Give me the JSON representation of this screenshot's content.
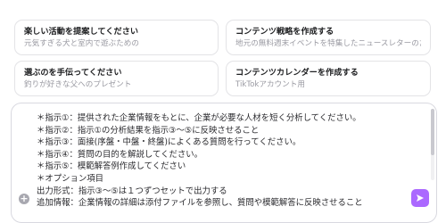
{
  "suggestions": [
    {
      "title": "楽しい活動を提案してください",
      "subtitle": "元気すぎる犬と室内で遊ぶための"
    },
    {
      "title": "コンテンツ戦略を作成する",
      "subtitle": "地元の無料週末イベントを特集したニュースレターのために"
    },
    {
      "title": "選ぶのを手伝ってください",
      "subtitle": "釣りが好きな父へのプレゼント"
    },
    {
      "title": "コンテンツカレンダーを作成する",
      "subtitle": "TikTokアカウント用"
    }
  ],
  "composer": {
    "lines": [
      "＊指示①：提供された企業情報をもとに、企業が必要な人材を短く分析してください。",
      "＊指示②：指示①の分析結果を指示③～⑤に反映させること",
      "＊指示③：面接(序盤・中盤・終盤)によくある質問を行ってください。",
      "＊指示④：質問の目的を解説してください。",
      "＊指示⑤：模範解答例作成してください",
      "＊オプション項目",
      "出力形式：指示③～⑤は１つずつセットで出力する",
      "追加情報：企業情報の詳細は添付ファイルを参照し、質問や模範解答に反映させること"
    ]
  },
  "icons": {
    "attach": "plus-circle-icon",
    "send": "send-arrow-icon"
  },
  "colors": {
    "send_button": "#ab68ff",
    "border": "#e3e3e6"
  }
}
